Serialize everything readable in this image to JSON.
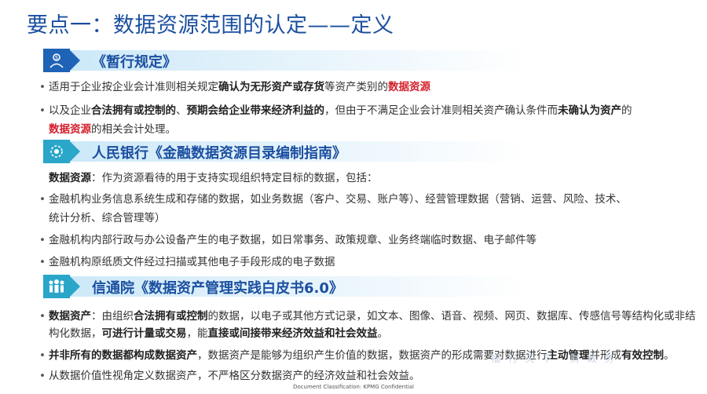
{
  "title": "要点一：数据资源范围的认定——定义",
  "sections": [
    {
      "heading": "《暂行规定》",
      "icon": "dollar-person-icon",
      "color": "#1e63b6",
      "lines": [
        [
          "适用于企业按企业会计准则相关规定",
          "确认为无形资产或存货",
          "等资产类别的",
          "数据资源"
        ],
        [
          "以及企业",
          "合法拥有或控制的",
          "、",
          "预期会给企业带来经济利益的",
          "，但由于不满足企业会计准则相关资产确认条件而",
          "未确认为资产",
          "的"
        ],
        [
          "数据资源",
          "的相关会计处理。"
        ]
      ]
    },
    {
      "heading": "人民银行《金融数据资源目录编制指南》",
      "icon": "bank-gear-icon",
      "color": "#2aa6c9",
      "intro": [
        "数据资源",
        "：作为资源看待的用于支持实现组织特定目标的数据，包括："
      ],
      "lines": [
        "金融机构业务信息系统生成和存储的数据，如业务数据（客户、交易、账户等）、经营管理数据（营销、运营、风险、技术、",
        "统计分析、综合管理等）",
        "金融机构内部行政与办公设备产生的电子数据，如日常事务、政策规章、业务终端临时数据、电子邮件等",
        "金融机构原纸质文件经过扫描或其他电子手段形成的电子数据"
      ]
    },
    {
      "heading": "信通院《数据资产管理实践白皮书6.0》",
      "icon": "people-group-icon",
      "color": "#2aa6c9",
      "lines": [
        [
          "数据资产",
          "：由组织",
          "合法拥有或控制",
          "的数据，以电子或其他方式记录，如文本、图像、语音、视频、网页、数据库、传感信号等结构化或非结"
        ],
        [
          "构化数据，",
          "可进行计量或交易",
          "，能",
          "直接或间接带来经济效益和社会效益",
          "。"
        ],
        [
          "并非所有的数据都构成数据资产",
          "，数据资产是能够为组织产生价值的数据，数据资产的形成需要对数据进行",
          "主动管理",
          "并形成",
          "有效控制",
          "。"
        ],
        [
          "从数据价值性视角定义数据资产，不严格区分数据资产的经济效益和社会效益。"
        ]
      ]
    }
  ],
  "watermark": "福 行 天 下 · 财 政 务",
  "footer": "Document Classification: KPMG Confidential"
}
